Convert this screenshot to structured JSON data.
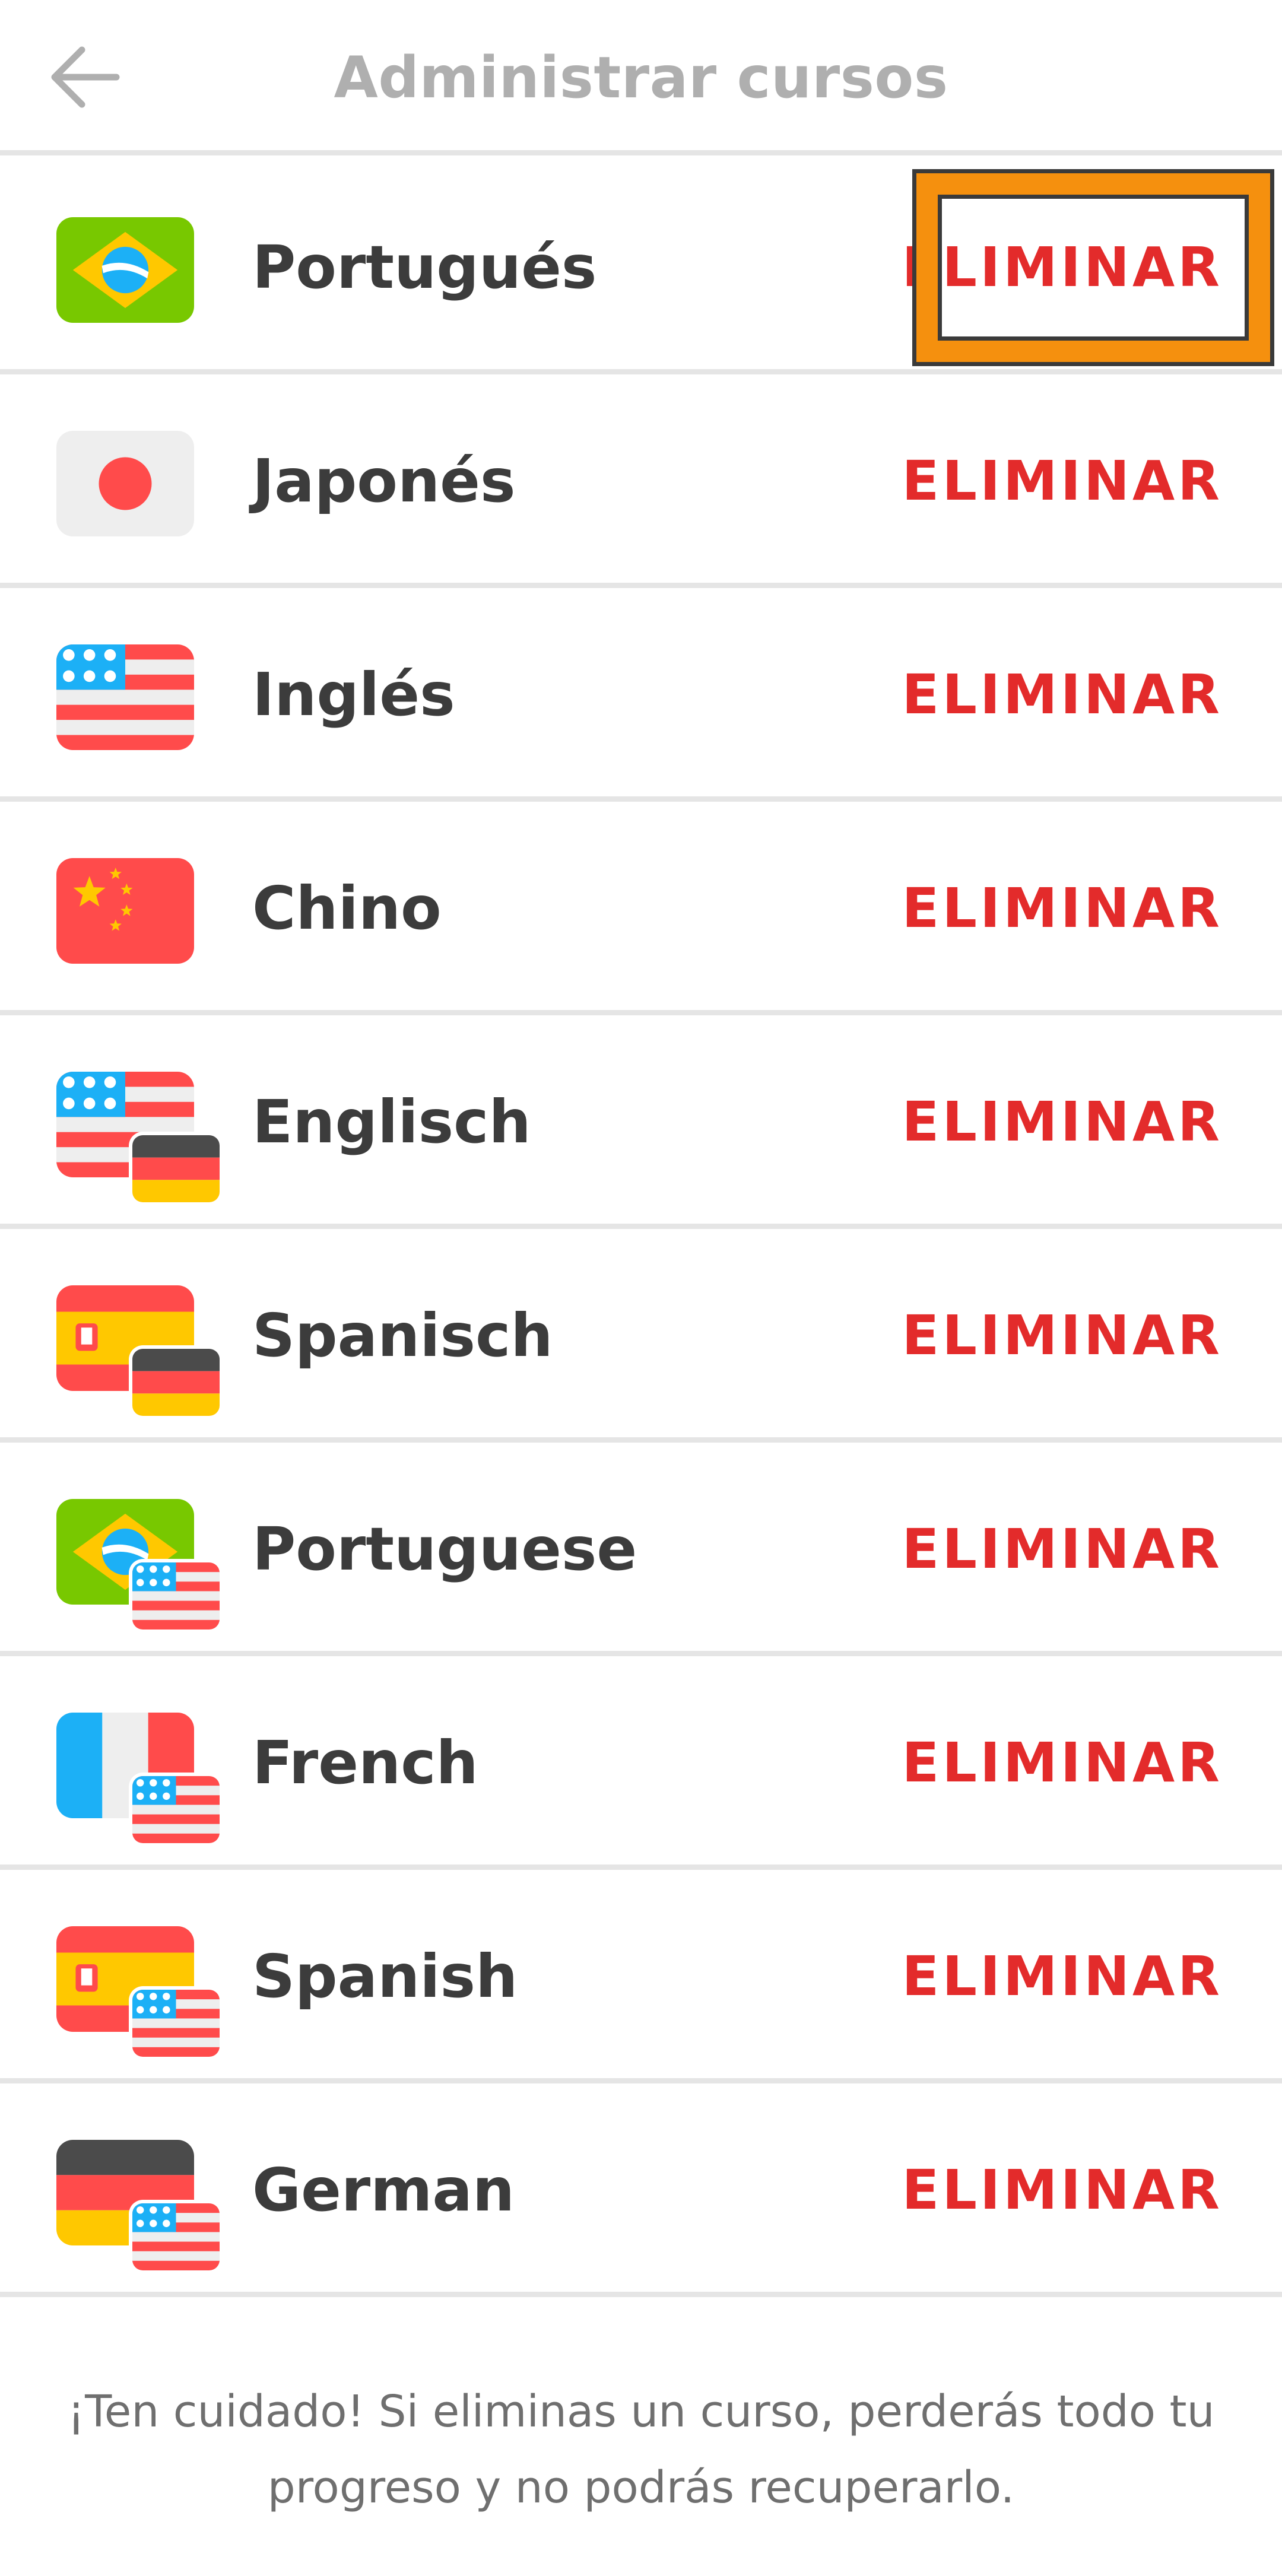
{
  "header": {
    "title": "Administrar cursos",
    "back_icon": "arrow-left-icon"
  },
  "courses": [
    {
      "name": "Portugués",
      "flag": "brazil",
      "base_flag": null,
      "remove_label": "ELIMINAR",
      "highlighted": true
    },
    {
      "name": "Japonés",
      "flag": "japan",
      "base_flag": null,
      "remove_label": "ELIMINAR"
    },
    {
      "name": "Inglés",
      "flag": "usa",
      "base_flag": null,
      "remove_label": "ELIMINAR"
    },
    {
      "name": "Chino",
      "flag": "china",
      "base_flag": null,
      "remove_label": "ELIMINAR"
    },
    {
      "name": "Englisch",
      "flag": "usa",
      "base_flag": "germany",
      "remove_label": "ELIMINAR"
    },
    {
      "name": "Spanisch",
      "flag": "spain",
      "base_flag": "germany",
      "remove_label": "ELIMINAR"
    },
    {
      "name": "Portuguese",
      "flag": "brazil",
      "base_flag": "usa",
      "remove_label": "ELIMINAR"
    },
    {
      "name": "French",
      "flag": "france",
      "base_flag": "usa",
      "remove_label": "ELIMINAR"
    },
    {
      "name": "Spanish",
      "flag": "spain",
      "base_flag": "usa",
      "remove_label": "ELIMINAR"
    },
    {
      "name": "German",
      "flag": "germany",
      "base_flag": "usa",
      "remove_label": "ELIMINAR"
    }
  ],
  "warning": "¡Ten cuidado! Si eliminas un curso, perderás todo tu progreso y no podrás recuperarlo.",
  "colors": {
    "remove": "#e32b2b",
    "highlight": "#f5900e",
    "title": "#afafaf",
    "text": "#3c3c3c"
  }
}
